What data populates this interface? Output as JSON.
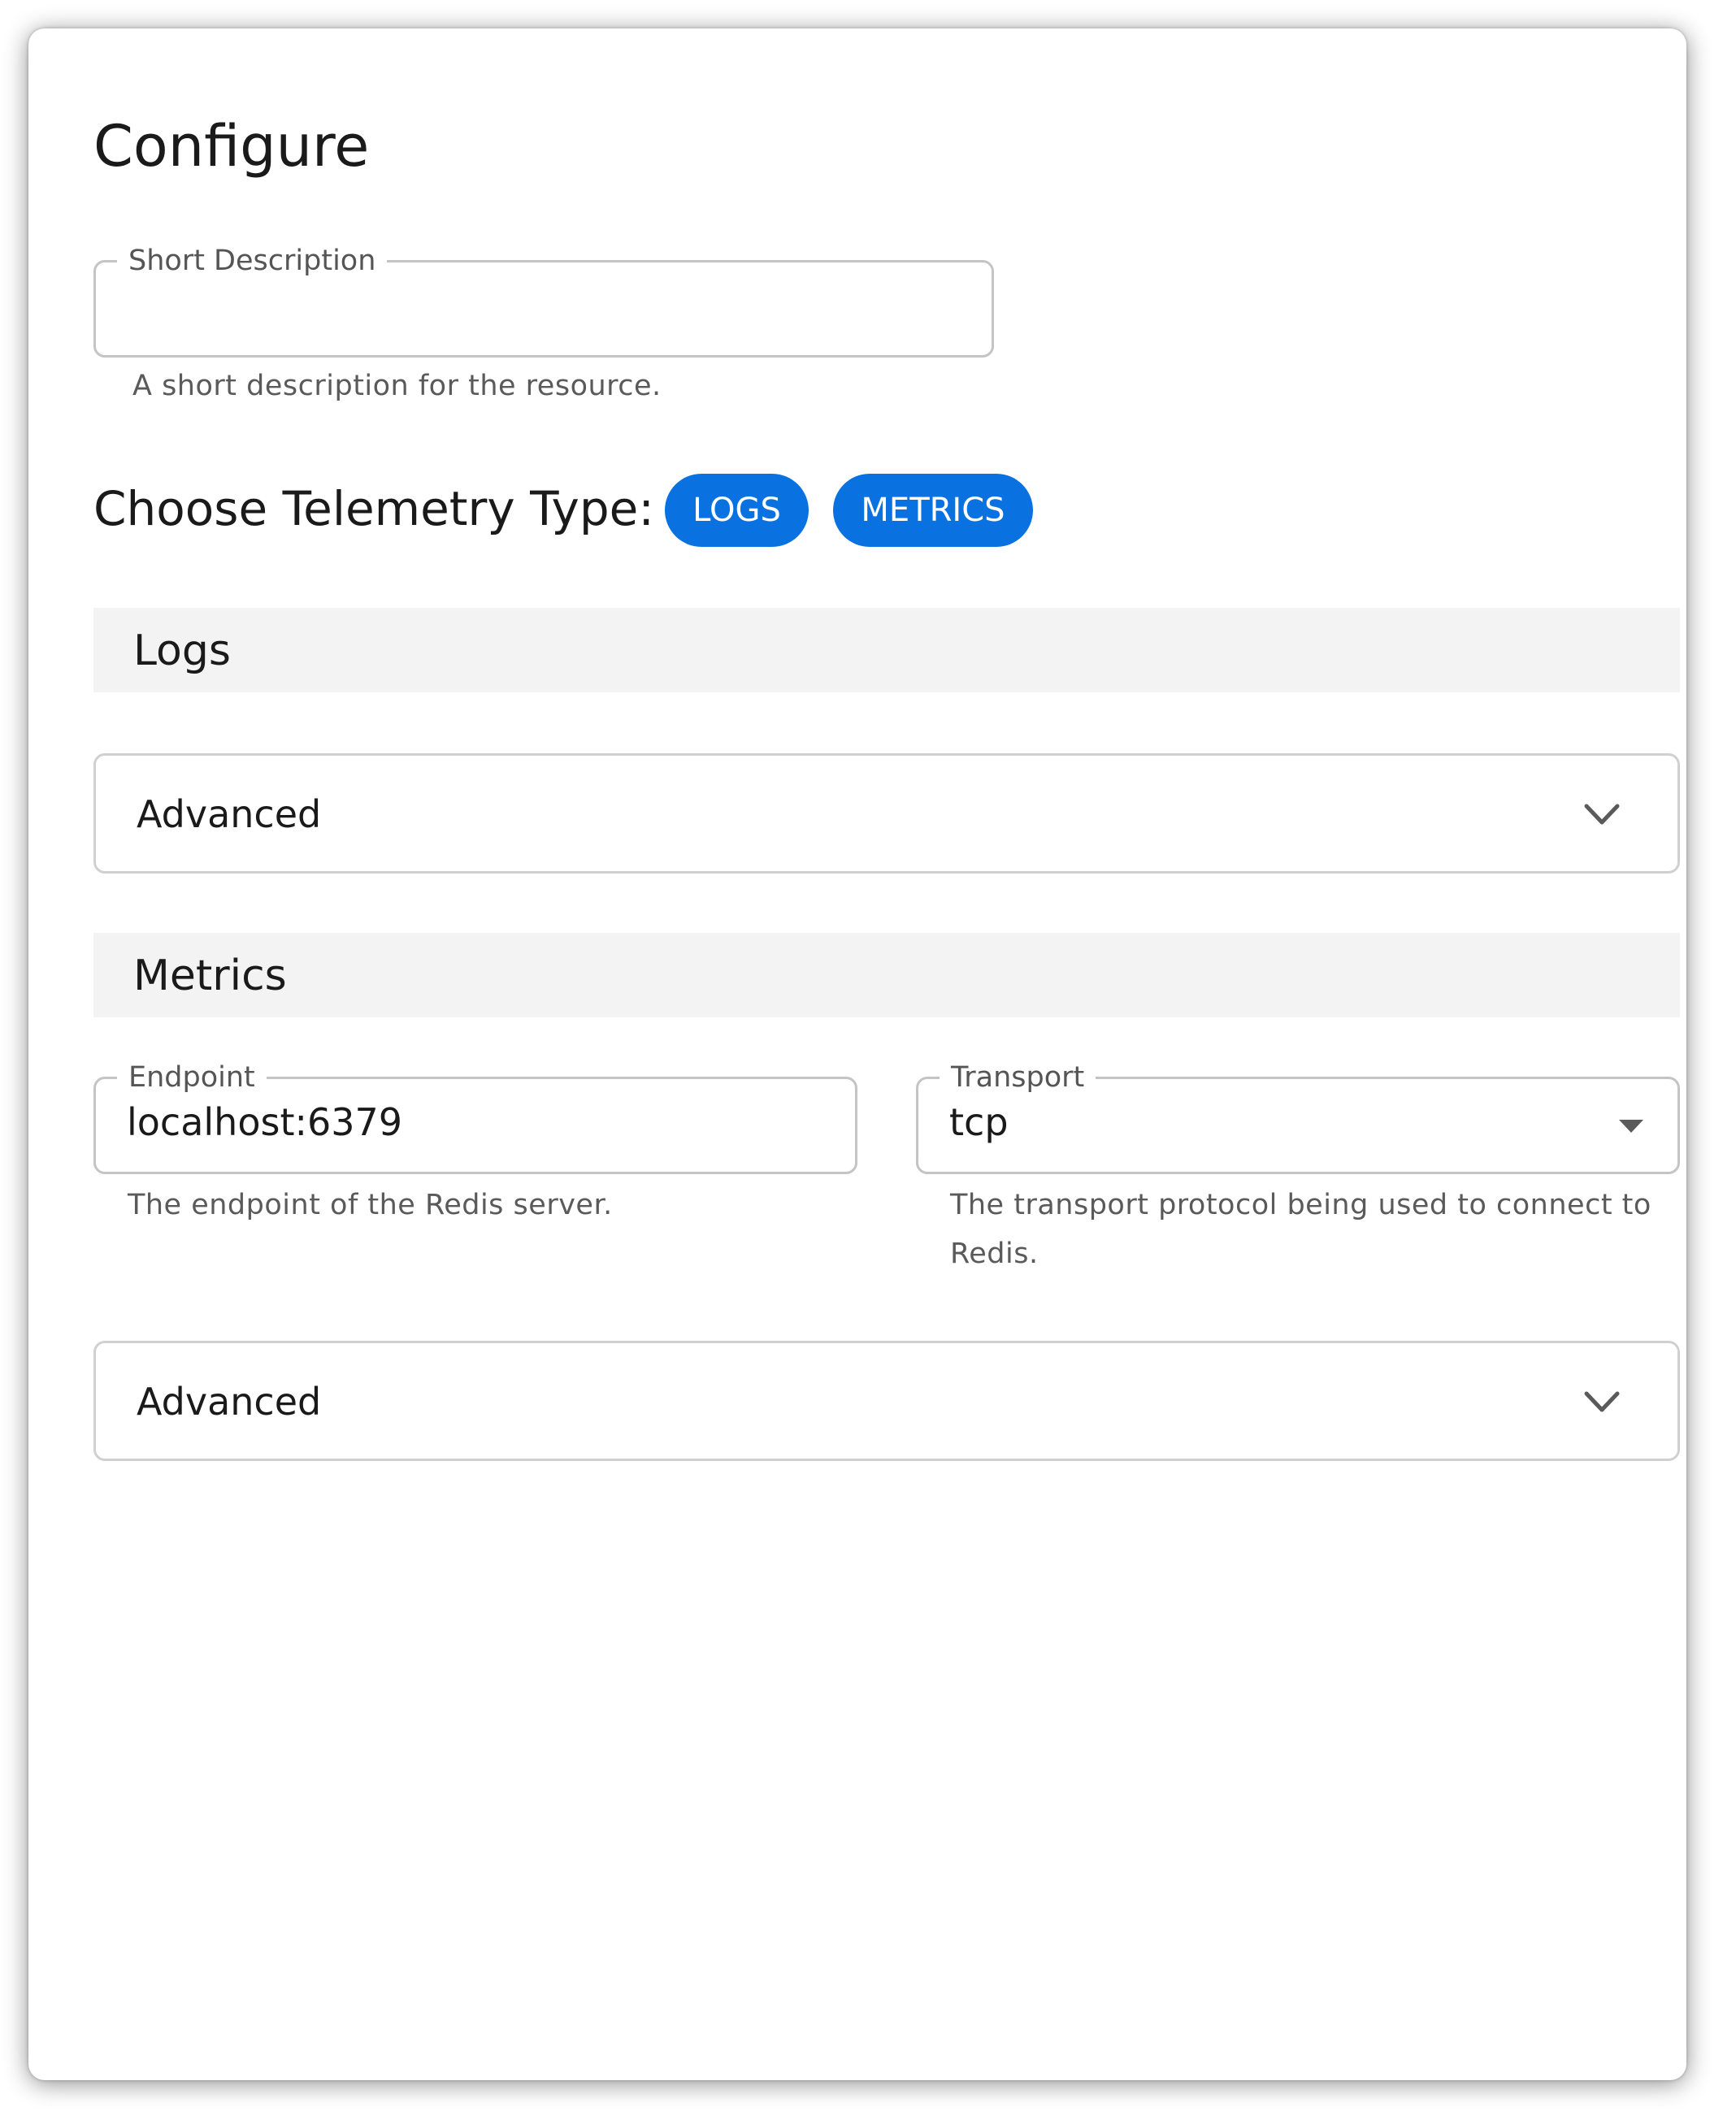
{
  "page": {
    "title": "Configure"
  },
  "short_description": {
    "label": "Short Description",
    "value": "",
    "helper": "A short description for the resource."
  },
  "telemetry": {
    "label": "Choose Telemetry Type:",
    "chips": [
      "LOGS",
      "METRICS"
    ],
    "chip_color": "#0a72e0"
  },
  "logs_section": {
    "heading": "Logs",
    "advanced_label": "Advanced",
    "advanced_icon": "chevron-down-icon"
  },
  "metrics_section": {
    "heading": "Metrics",
    "endpoint": {
      "label": "Endpoint",
      "value": "localhost:6379",
      "helper": "The endpoint of the Redis server."
    },
    "transport": {
      "label": "Transport",
      "value": "tcp",
      "helper_line1": "The transport protocol being used to connect to",
      "helper_line2": "Redis.",
      "icon": "dropdown-arrow-icon"
    },
    "advanced_label": "Advanced",
    "advanced_icon": "chevron-down-icon"
  }
}
